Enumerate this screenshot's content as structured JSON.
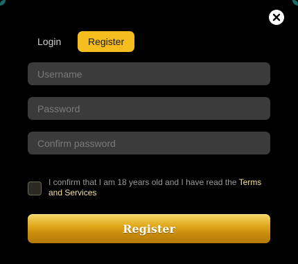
{
  "modal": {
    "close_icon": "close-icon"
  },
  "tabs": [
    {
      "label": "Login",
      "active": false
    },
    {
      "label": "Register",
      "active": true
    }
  ],
  "form": {
    "username_placeholder": "Username",
    "password_placeholder": "Password",
    "confirm_placeholder": "Confirm password",
    "consent_text": "I confirm that I am 18 years old and I have read the ",
    "consent_link": "Terms and Services",
    "submit_label": "Register"
  },
  "colors": {
    "accent": "#f6bd1f",
    "field_bg": "#3b3b3b",
    "background": "#000000"
  }
}
